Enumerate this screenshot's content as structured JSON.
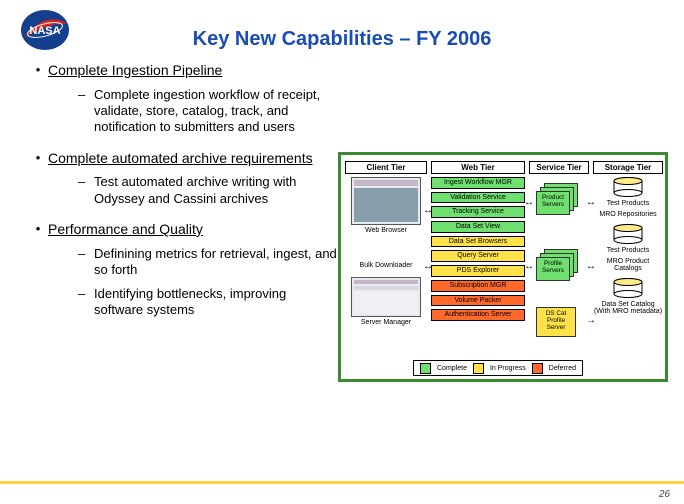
{
  "title": "Key New Capabilities – FY 2006",
  "page_number": "26",
  "bullets": [
    {
      "head": "Complete Ingestion Pipeline",
      "subs": [
        "Complete ingestion workflow of receipt, validate, store, catalog, track, and notification to submitters and users"
      ]
    },
    {
      "head": "Complete automated archive requirements",
      "subs": [
        "Test automated archive writing with Odyssey and Cassini archives"
      ]
    },
    {
      "head": "Performance and Quality",
      "subs": [
        "Definining metrics for retrieval, ingest, and so forth",
        "Identifying bottlenecks, improving software systems"
      ]
    }
  ],
  "diagram": {
    "headers": [
      "Client Tier",
      "Web Tier",
      "Service Tier",
      "Storage Tier"
    ],
    "client": {
      "browser_label": "Web Browser",
      "bulk_label": "Bulk Downloader",
      "server_label": "Server Manager"
    },
    "web": {
      "boxes": [
        {
          "t": "Ingest Workflow MGR",
          "c": "g"
        },
        {
          "t": "Validation Service",
          "c": "g"
        },
        {
          "t": "Tracking Service",
          "c": "g"
        },
        {
          "t": "Data Set View",
          "c": "g"
        },
        {
          "t": "Data Set Browsers",
          "c": "y"
        },
        {
          "t": "Query Server",
          "c": "y"
        },
        {
          "t": "PDS Explorer",
          "c": "y"
        },
        {
          "t": "Subscription MGR",
          "c": "o"
        },
        {
          "t": "Volume Packer",
          "c": "o"
        },
        {
          "t": "Authentication Server",
          "c": "o"
        }
      ]
    },
    "service": {
      "product": "Product Servers",
      "profile": "Profile Servers",
      "dscat": "DS Cat Profile Server"
    },
    "storage": {
      "test": "Test Products",
      "repo": "MRO Repositories",
      "testprod": "Test Products",
      "mrocat": "MRO Product Catalogs",
      "dscat": "Data Set Catalog (With MRO metadata)"
    },
    "legend": {
      "complete": "Complete",
      "inprogress": "In Progress",
      "deferred": "Deferred"
    }
  }
}
